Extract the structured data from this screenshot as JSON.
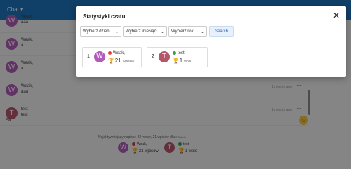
{
  "app": {
    "title": "Chat ▾"
  },
  "chat_rows": [
    {
      "avatar_letter": "W",
      "name": "Weak,",
      "message": "aaa",
      "time": "",
      "more": ""
    },
    {
      "avatar_letter": "W",
      "name": "Weak,",
      "message": "a",
      "time": "",
      "more": ""
    },
    {
      "avatar_letter": "W",
      "name": "Weak,",
      "message": "a",
      "time": "",
      "more": ""
    },
    {
      "avatar_letter": "W",
      "name": "Weak,",
      "message": "aaa",
      "time": "1 minute ago",
      "more": "···"
    },
    {
      "avatar_letter": "T",
      "name": "test",
      "message": "test",
      "time": "1 minute ago",
      "more": "···"
    }
  ],
  "composer_text": "Aa",
  "footer": {
    "summary": "Najaktywniejszy napisał: 22 wpisy, 21 wpisów dla",
    "summary_suffix": "2 Tabele",
    "items": [
      {
        "avatar_letter": "W",
        "name": "Weak,",
        "count": "21 wpisów"
      },
      {
        "avatar_letter": "T",
        "name": "test",
        "count": "1 wpis"
      }
    ]
  },
  "modal": {
    "title": "Statystyki czatu",
    "close_label": "✕",
    "filters": {
      "day": "Wybierz dzień",
      "month": "Wybierz miesiąc",
      "year": "Wybierz rok",
      "search": "Search"
    },
    "stats": [
      {
        "rank": "1",
        "avatar_letter": "W",
        "name": "Weak,",
        "status": "red",
        "count": "21",
        "unit": "wpisów",
        "trophy": "gold"
      },
      {
        "rank": "2",
        "avatar_letter": "T",
        "name": "test",
        "status": "green",
        "count": "1",
        "unit": "wpis",
        "trophy": "silver"
      }
    ]
  },
  "colors": {
    "primary": "#1e73be",
    "avatar_w": "#b05bb8",
    "avatar_t": "#b5576a",
    "status_red": "#e53935",
    "status_green": "#2e9e4a"
  }
}
